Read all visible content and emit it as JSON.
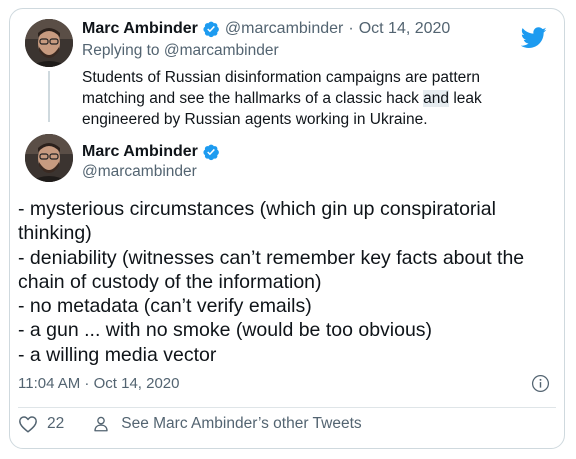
{
  "quoted_tweet": {
    "author_name": "Marc Ambinder",
    "author_handle": "@marcambinder",
    "separator": "·",
    "date": "Oct 14, 2020",
    "replying_to": "Replying to @marcambinder",
    "text_before": "Students of Russian disinformation campaigns are pattern matching and see the hallmarks of a classic hack ",
    "text_highlight": "and",
    "text_after": " leak engineered by Russian agents working in Ukraine."
  },
  "main_tweet": {
    "author_name": "Marc Ambinder",
    "author_handle": "@marcambinder",
    "lines": [
      "- mysterious circumstances (which gin up conspiratorial",
      "thinking)",
      "- deniability (witnesses can’t remember key facts about the",
      "chain of custody of the information)",
      "- no metadata (can’t verify emails)",
      "- a gun ... with no smoke (would be too obvious)",
      "- a willing media vector"
    ],
    "timestamp": "11:04 AM · Oct 14, 2020",
    "like_count": "22",
    "see_more_label": "See Marc Ambinder’s other Tweets"
  },
  "colors": {
    "twitter_blue": "#1d9bf0",
    "secondary_text": "#536471",
    "border": "#cfd9de"
  },
  "icons": [
    "twitter-logo-icon",
    "verified-badge-icon",
    "info-icon",
    "heart-icon",
    "person-icon"
  ]
}
